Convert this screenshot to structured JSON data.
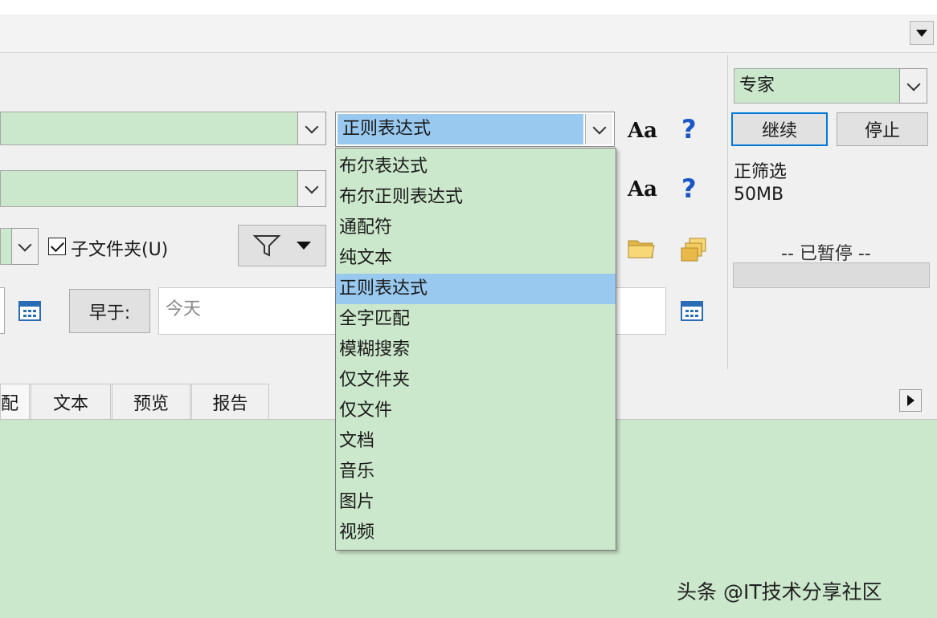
{
  "mode": {
    "value": "专家"
  },
  "search_type": {
    "value": "正则表达式",
    "options": [
      "布尔表达式",
      "布尔正则表达式",
      "通配符",
      "纯文本",
      "正则表达式",
      "全字匹配",
      "模糊搜索",
      "仅文件夹",
      "仅文件",
      "文档",
      "音乐",
      "图片",
      "视频"
    ],
    "selected_index": 4
  },
  "case_label": "Aa",
  "help_label": "?",
  "buttons": {
    "continue": "继续",
    "stop": "停止",
    "earlier": "早于:"
  },
  "status": {
    "filter": "正筛选",
    "size": "50MB",
    "paused": "-- 已暂停 --"
  },
  "subfolders": {
    "label": "子文件夹(U)",
    "checked": true
  },
  "date_input": {
    "value": "今天"
  },
  "tabs": {
    "partial": "配",
    "text": "文本",
    "preview": "预览",
    "report": "报告"
  },
  "watermark": "头条 @IT技术分享社区",
  "colors": {
    "field_bg": "#cce8cc",
    "selection": "#99c9ef",
    "accent": "#0078d7",
    "help": "#1a56c8"
  }
}
